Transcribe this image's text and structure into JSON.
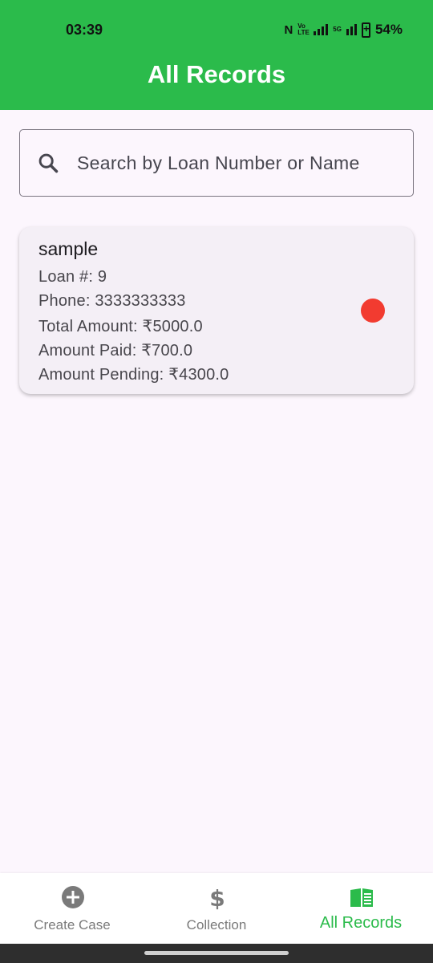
{
  "status_bar": {
    "time": "03:39",
    "nfc": "N",
    "volte1": "Vo LTE",
    "volte2": "5G",
    "battery": "54%"
  },
  "header": {
    "title": "All Records"
  },
  "search": {
    "placeholder": "Search by Loan Number or Name",
    "value": ""
  },
  "records": [
    {
      "name": "sample",
      "loan": "Loan #: 9",
      "phone": "Phone: 3333333333",
      "total": "Total Amount: ₹5000.0",
      "paid": "Amount Paid: ₹700.0",
      "pending": "Amount Pending: ₹4300.0",
      "status_color": "#f23b30"
    }
  ],
  "bottom_nav": {
    "items": [
      {
        "label": "Create Case",
        "icon": "add-circle-icon"
      },
      {
        "label": "Collection",
        "icon": "dollar-icon"
      },
      {
        "label": "All Records",
        "icon": "book-icon",
        "active": true
      }
    ]
  },
  "colors": {
    "primary": "#2bbb4b",
    "background": "#fcf6fd",
    "card": "#f4eff6"
  }
}
